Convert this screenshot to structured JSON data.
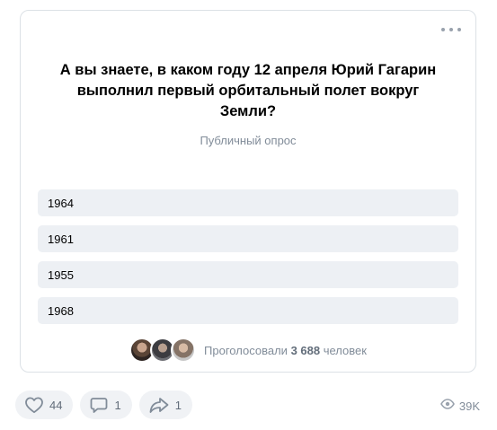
{
  "poll": {
    "question": "А вы знаете, в каком году 12 апреля Юрий Гагарин выполнил первый орбитальный полет вокруг Земли?",
    "type_label": "Публичный опрос",
    "options": [
      {
        "label": "1964"
      },
      {
        "label": "1961"
      },
      {
        "label": "1955"
      },
      {
        "label": "1968"
      }
    ],
    "voters": {
      "prefix": "Проголосовали",
      "count": "3 688",
      "suffix": "человек"
    }
  },
  "actions": {
    "likes": "44",
    "comments": "1",
    "shares": "1",
    "views": "39K"
  },
  "icons": {
    "more": "more-horizontal-icon",
    "like": "heart-icon",
    "comment": "comment-icon",
    "share": "share-arrow-icon",
    "views": "eye-icon"
  },
  "colors": {
    "option_background": "#edf0f4",
    "secondary_text": "#818c99",
    "icon": "#99a2ad",
    "button_background": "#f0f2f5"
  }
}
